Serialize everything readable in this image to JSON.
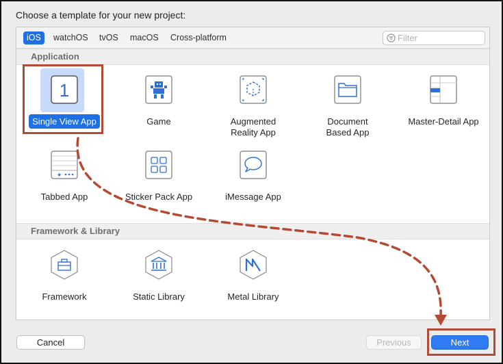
{
  "dialog": {
    "heading": "Choose a template for your new project:"
  },
  "tabs": [
    {
      "label": "iOS",
      "selected": true
    },
    {
      "label": "watchOS"
    },
    {
      "label": "tvOS"
    },
    {
      "label": "macOS"
    },
    {
      "label": "Cross-platform"
    }
  ],
  "filter": {
    "placeholder": "Filter",
    "value": ""
  },
  "sections": {
    "application": "Application",
    "framework": "Framework & Library"
  },
  "templates": {
    "single_view": {
      "label": "Single View App",
      "icon": "single-view-app-icon",
      "badge": "1",
      "selected": true
    },
    "game": {
      "label": "Game",
      "icon": "game-icon"
    },
    "ar": {
      "line1": "Augmented",
      "line2": "Reality App",
      "icon": "augmented-reality-icon"
    },
    "document": {
      "line1": "Document",
      "line2": "Based App",
      "icon": "document-folder-icon"
    },
    "master_detail": {
      "label": "Master-Detail App",
      "icon": "master-detail-icon"
    },
    "tabbed": {
      "label": "Tabbed App",
      "icon": "tabbed-app-icon"
    },
    "sticker": {
      "label": "Sticker Pack App",
      "icon": "sticker-grid-icon"
    },
    "imessage": {
      "label": "iMessage App",
      "icon": "message-bubble-icon"
    },
    "framework": {
      "label": "Framework",
      "icon": "toolbox-hexagon-icon"
    },
    "static_library": {
      "label": "Static Library",
      "icon": "library-building-hexagon-icon"
    },
    "metal_library": {
      "label": "Metal Library",
      "icon": "metal-hexagon-icon"
    }
  },
  "buttons": {
    "cancel": "Cancel",
    "previous": "Previous",
    "next": "Next"
  },
  "colors": {
    "accent": "#1f6fe5",
    "highlight": "#b44a33",
    "icon_blue": "#2f6fd6"
  }
}
